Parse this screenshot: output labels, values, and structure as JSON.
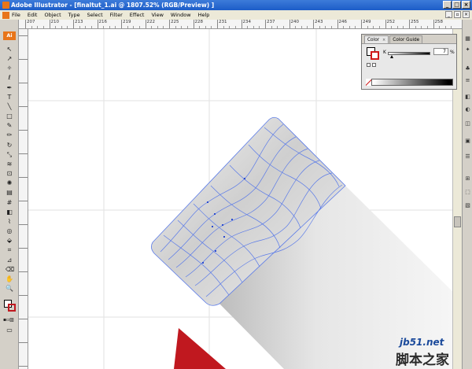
{
  "window": {
    "title": "Adobe Illustrator - [finaltut_1.ai @ 1807.52% (RGB/Preview) ]"
  },
  "menubar": {
    "items": [
      "File",
      "Edit",
      "Object",
      "Type",
      "Select",
      "Filter",
      "Effect",
      "View",
      "Window",
      "Help"
    ]
  },
  "toolbar": {
    "logo": "Ai"
  },
  "ruler": {
    "top_labels": [
      "207",
      "210",
      "213",
      "216",
      "219",
      "222",
      "225",
      "228",
      "231",
      "234",
      "237",
      "240",
      "243",
      "246",
      "249",
      "252",
      "255",
      "258"
    ]
  },
  "color_panel": {
    "tabs": [
      {
        "label": "Color",
        "close": "×"
      },
      {
        "label": "Color Guide"
      }
    ],
    "channel_label": "K",
    "value": "7",
    "unit": "%"
  },
  "watermark": {
    "site": "jb51.net",
    "name": "脚本之家"
  },
  "colors": {
    "accent": "#e8751a",
    "mesh": "#5b7be8",
    "red_shape": "#c0181f"
  }
}
